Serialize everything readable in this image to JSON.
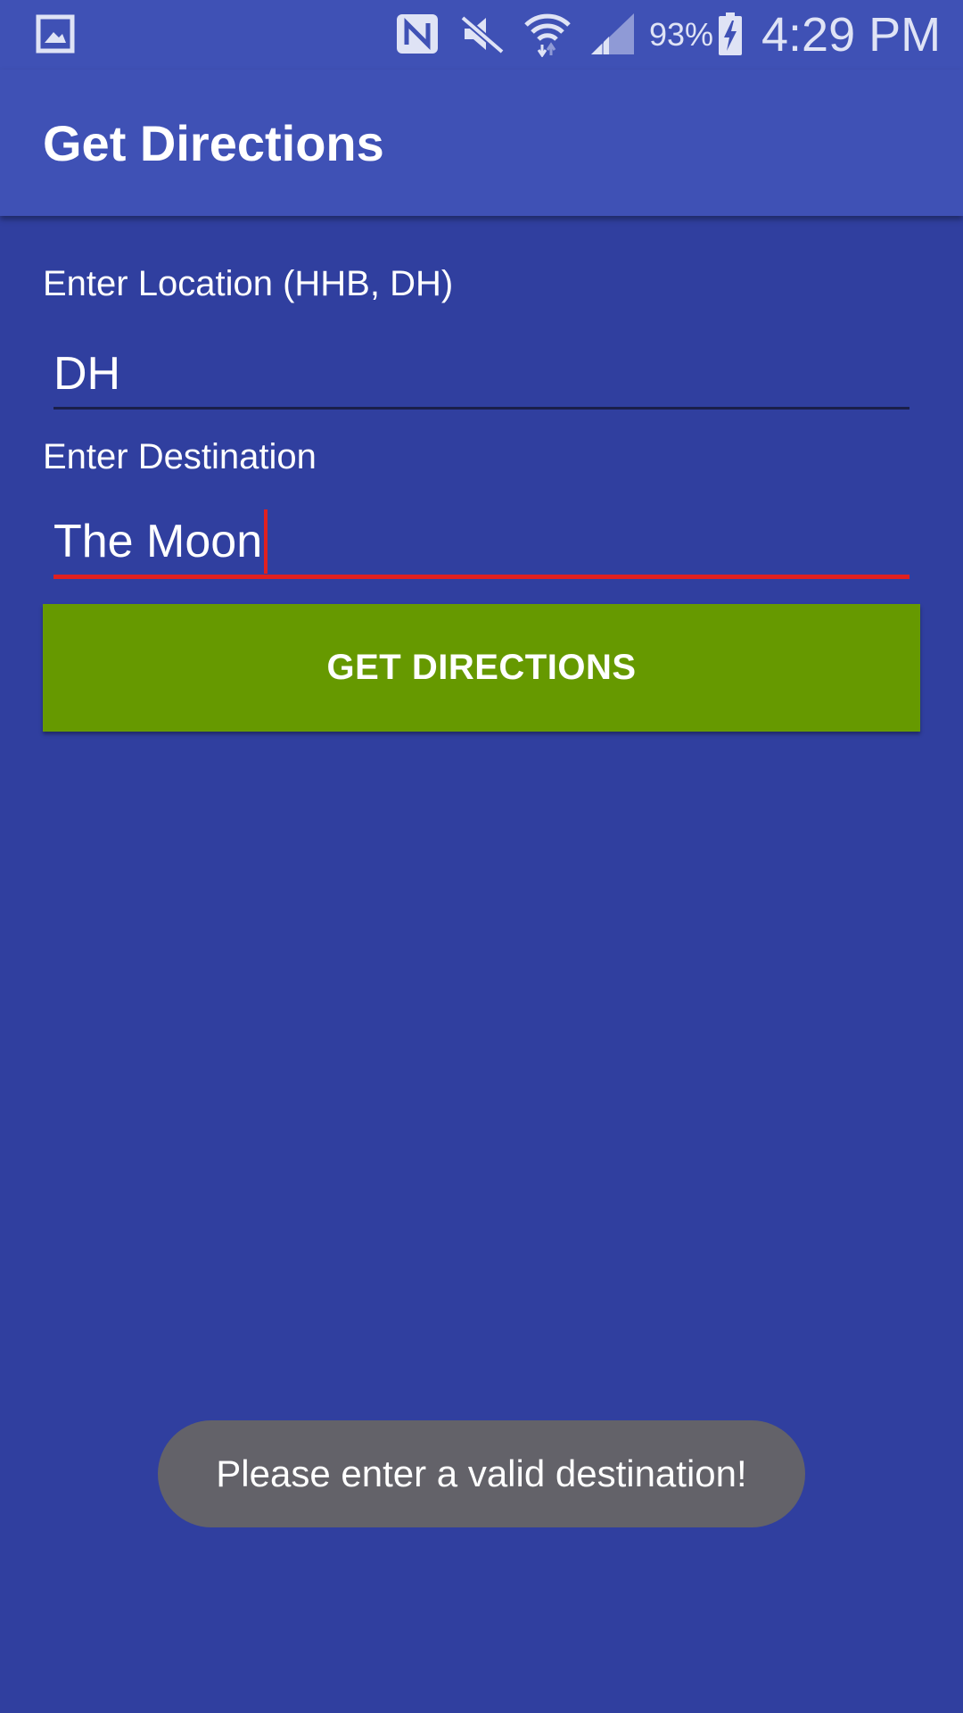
{
  "status_bar": {
    "icons": [
      "gallery-icon",
      "nfc-icon",
      "mute-icon",
      "wifi-icon",
      "signal-icon",
      "battery-charging-icon"
    ],
    "battery_percent": "93%",
    "time": "4:29 PM"
  },
  "app_bar": {
    "title": "Get Directions"
  },
  "form": {
    "location_label": "Enter Location (HHB, DH)",
    "location_value": "DH",
    "destination_label": "Enter Destination",
    "destination_value": "The Moon",
    "submit_label": "GET DIRECTIONS"
  },
  "toast": {
    "message": "Please enter a valid destination!"
  },
  "colors": {
    "primary": "#3f51b5",
    "background": "#303f9f",
    "button": "#669900",
    "error": "#e02020",
    "toast": "#636269"
  }
}
